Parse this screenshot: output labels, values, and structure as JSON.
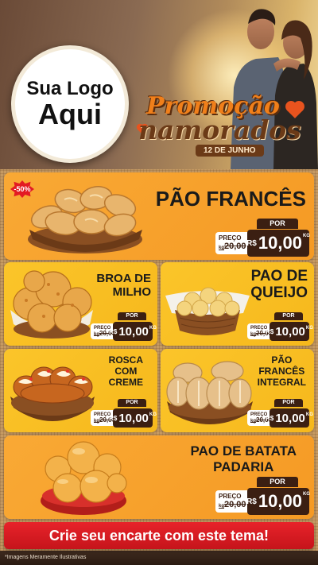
{
  "header": {
    "logo_line1": "Sua Logo",
    "logo_line2": "Aqui",
    "promo_line1": "Promoção",
    "promo_line2": "namorados",
    "promo_date": "12 DE JUNHO"
  },
  "products": [
    {
      "name": "PÃO FRANCÊS",
      "badge": "-50%",
      "por": "POR",
      "old_label": "PREÇO",
      "old_unit": "kg",
      "old_price": "20,00",
      "currency": "R$",
      "price": "10,00",
      "unit": "KG"
    },
    {
      "name_l1": "BROA DE",
      "name_l2": "MILHO",
      "por": "POR",
      "old_label": "PREÇO",
      "old_unit": "kg",
      "old_price": "20,00",
      "currency": "R$",
      "price": "10,00",
      "unit": "KG"
    },
    {
      "name_l1": "PAO DE",
      "name_l2": "QUEIJO",
      "por": "POR",
      "old_label": "PREÇO",
      "old_unit": "kg",
      "old_price": "20,00",
      "currency": "R$",
      "price": "10,00",
      "unit": "KG"
    },
    {
      "name_l1": "ROSCA",
      "name_l2": "COM",
      "name_l3": "CREME",
      "por": "POR",
      "old_label": "PREÇO",
      "old_unit": "kg",
      "old_price": "20,00",
      "currency": "R$",
      "price": "10,00",
      "unit": "KG"
    },
    {
      "name_l1": "PÃO",
      "name_l2": "FRANCÊS",
      "name_l3": "INTEGRAL",
      "por": "POR",
      "old_label": "PREÇO",
      "old_unit": "kg",
      "old_price": "20,00",
      "currency": "R$",
      "price": "10,00",
      "unit": "KG"
    },
    {
      "name_l1": "PAO DE BATATA",
      "name_l2": "PADARIA",
      "por": "POR",
      "old_label": "PREÇO",
      "old_unit": "kg",
      "old_price": "20,00",
      "currency": "R$",
      "price": "10,00",
      "unit": "KG"
    }
  ],
  "cta": "Crie seu encarte com este tema!",
  "disclaimer": "*Imagens Meramente Ilustrativas",
  "colors": {
    "orange_card": "#f59a24",
    "yellow_card": "#fbc52a",
    "price_bg": "#3b1f12",
    "cta_red": "#d81a21",
    "badge_red": "#e31b23"
  }
}
